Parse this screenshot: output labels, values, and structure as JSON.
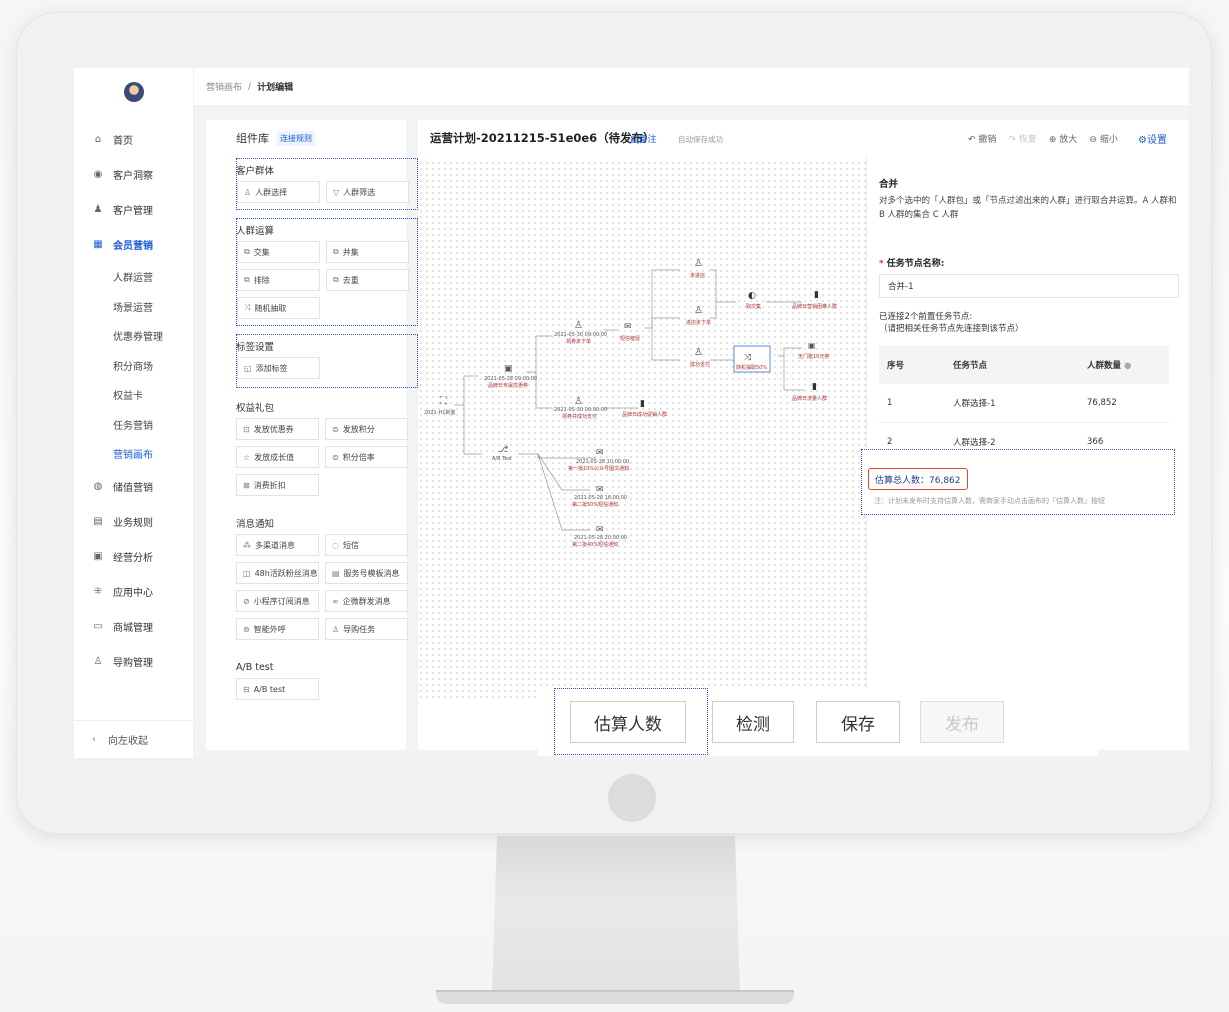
{
  "breadcrumb": {
    "parent": "营销画布",
    "separator": "/",
    "current": "计划编辑"
  },
  "sidebar": {
    "items": [
      {
        "label": "首页",
        "icon": "home-icon"
      },
      {
        "label": "客户洞察",
        "icon": "eye-icon"
      },
      {
        "label": "客户管理",
        "icon": "user-icon"
      },
      {
        "label": "会员营销",
        "icon": "gift-icon",
        "active": true
      }
    ],
    "sub_items": [
      "人群运营",
      "场景运营",
      "优惠券管理",
      "积分商场",
      "权益卡",
      "任务营销",
      "营销画布"
    ],
    "current_sub": "营销画布",
    "items_after": [
      {
        "label": "储值营销",
        "icon": "wallet-icon"
      },
      {
        "label": "业务规则",
        "icon": "rules-icon"
      },
      {
        "label": "经营分析",
        "icon": "analysis-icon"
      },
      {
        "label": "应用中心",
        "icon": "apps-icon"
      },
      {
        "label": "商城管理",
        "icon": "store-icon"
      },
      {
        "label": "导购管理",
        "icon": "guide-icon"
      }
    ],
    "collapse_label": "向左收起"
  },
  "library": {
    "title": "组件库",
    "link": "连接规则",
    "groups": [
      {
        "title": "客户群体",
        "items": [
          "人群选择",
          "人群筛选"
        ]
      },
      {
        "title": "人群运算",
        "items": [
          "交集",
          "并集",
          "排除",
          "去重",
          "随机抽取"
        ]
      },
      {
        "title": "标签设置",
        "items": [
          "添加标签"
        ]
      },
      {
        "title": "权益礼包",
        "items": [
          "发放优惠券",
          "发放积分",
          "发放成长值",
          "积分倍率",
          "消费折扣"
        ]
      },
      {
        "title": "消息通知",
        "items": [
          "多渠道消息",
          "短信",
          "48h活跃粉丝消息",
          "服务号模板消息",
          "小程序订阅消息",
          "企微群发消息",
          "智能外呼",
          "导购任务"
        ]
      },
      {
        "title": "A/B test",
        "items": [
          "A/B test"
        ]
      }
    ]
  },
  "canvas": {
    "title": "运营计划-20211215-51e0e6（待发布）",
    "note": "备注",
    "autosave": "自动保存成功",
    "nodes": {
      "start": "2021-H1新客",
      "coupon_time": "2021-05-28 09:00:00",
      "coupon_name": "品牌日专属优惠券",
      "ab": "A/B Test",
      "left_time": "2021-05-30 09:00:00",
      "left_name": "领券未下单",
      "sms_name": "短信催促",
      "pay_time": "2021-05-30 00:00:00",
      "pay_name": "领券并成功支付",
      "pay_target": "品牌日成功促销人群",
      "not_enter": "未进店",
      "not_order": "进店未下单",
      "paid": "成功支付",
      "intersect": "取交集",
      "target1": "品牌日营销困难人群",
      "random": "随机抽取50%",
      "threshold": "无门槛10元券",
      "target2": "品牌日流量人群",
      "ab1_time": "2021-05-28 10:00:00",
      "ab1_name": "第一批10%公众号图文通知",
      "ab2_time": "2021-05-28 16:00:00",
      "ab2_name": "第二批50%短信通知",
      "ab3_time": "2021-05-28 20:00:00",
      "ab3_name": "第二批40%短信通知"
    }
  },
  "toolbar": {
    "undo": "撤销",
    "redo": "恢复",
    "zoom_in": "放大",
    "zoom_out": "缩小",
    "settings": "设置"
  },
  "props": {
    "title": "合并",
    "desc": "对多个选中的「人群包」或「节点过滤出来的人群」进行取合并运算。A 人群和 B 人群的集合 C 人群",
    "name_label": "任务节点名称:",
    "name_value": "合并-1",
    "connected": "已连接2个前置任务节点:",
    "connected_hint": "（请把相关任务节点先连接到该节点）",
    "table": {
      "headers": [
        "序号",
        "任务节点",
        "人群数量"
      ],
      "rows": [
        [
          "1",
          "人群选择-1",
          "76,852"
        ],
        [
          "2",
          "人群选择-2",
          "366"
        ]
      ]
    },
    "estimate": "估算总人数：76,862",
    "note": "注：计划未发布时支持估算人数，需商家手动点击画布的「估算人数」按钮"
  },
  "actions": {
    "estimate": "估算人数",
    "check": "检测",
    "save": "保存",
    "publish": "发布"
  }
}
